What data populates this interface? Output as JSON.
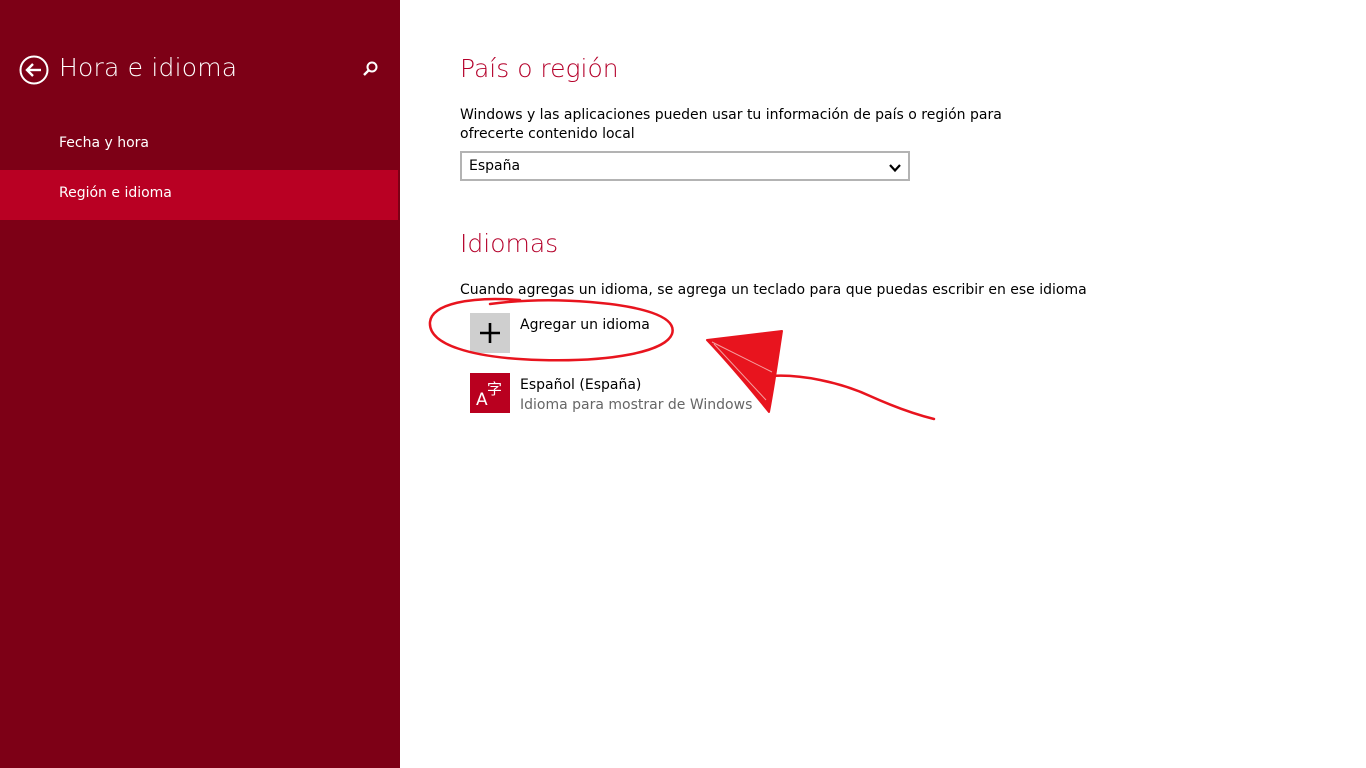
{
  "sidebar": {
    "title": "Hora e idioma",
    "back_icon": "back-arrow-icon",
    "search_icon": "search-icon",
    "items": [
      {
        "label": "Fecha y hora",
        "selected": false
      },
      {
        "label": "Región e idioma",
        "selected": true
      }
    ]
  },
  "region": {
    "title": "País o región",
    "description": "Windows y las aplicaciones pueden usar tu información de país o región para ofrecerte contenido local",
    "selected_country": "España"
  },
  "languages": {
    "title": "Idiomas",
    "description": "Cuando agregas un idioma, se agrega un teclado para que puedas escribir en ese idioma",
    "add_label": "Agregar un idioma",
    "items": [
      {
        "name": "Español (España)",
        "status": "Idioma para mostrar de Windows",
        "icon": "language-icon"
      }
    ]
  },
  "colors": {
    "sidebar_bg": "#7d0016",
    "sidebar_selected": "#b90023",
    "accent": "#b4002a",
    "annotation": "#e8141e"
  }
}
